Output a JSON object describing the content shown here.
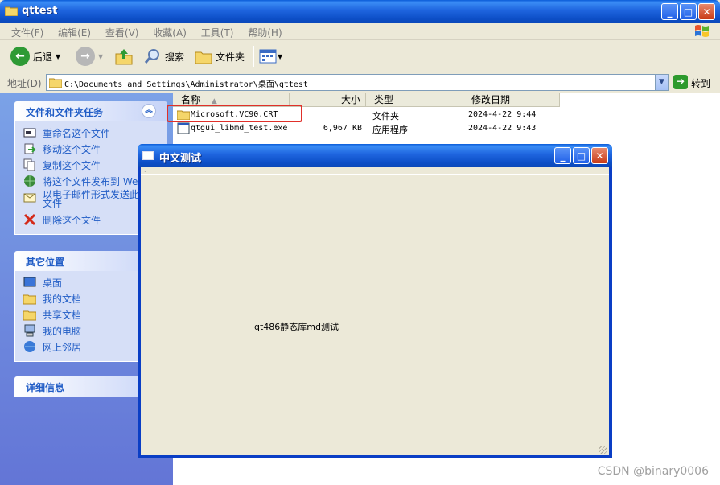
{
  "explorer": {
    "title": "qttest",
    "menu": [
      "文件(F)",
      "编辑(E)",
      "查看(V)",
      "收藏(A)",
      "工具(T)",
      "帮助(H)"
    ],
    "toolbar": {
      "back": "后退",
      "search": "搜索",
      "folders": "文件夹"
    },
    "address": {
      "label": "地址(D)",
      "value": "C:\\Documents and Settings\\Administrator\\桌面\\qttest",
      "go": "转到"
    }
  },
  "tasks": {
    "title": "文件和文件夹任务",
    "items": [
      "重命名这个文件",
      "移动这个文件",
      "复制这个文件",
      "将这个文件发布到 Web",
      "以电子邮件形式发送此文件",
      "删除这个文件"
    ]
  },
  "places": {
    "title": "其它位置",
    "items": [
      "桌面",
      "我的文档",
      "共享文档",
      "我的电脑",
      "网上邻居"
    ]
  },
  "details": {
    "title": "详细信息"
  },
  "columns": {
    "name": "名称",
    "size": "大小",
    "type": "类型",
    "date": "修改日期"
  },
  "files": [
    {
      "name": "Microsoft.VC90.CRT",
      "size": "",
      "type": "文件夹",
      "date": "2024-4-22 9:44"
    },
    {
      "name": "qtgui_libmd_test.exe",
      "size": "6,967 KB",
      "type": "应用程序",
      "date": "2024-4-22 9:43"
    }
  ],
  "dialog": {
    "title": "中文测试",
    "label": "qt486静态库md测试"
  },
  "watermark": "CSDN @binary0006"
}
